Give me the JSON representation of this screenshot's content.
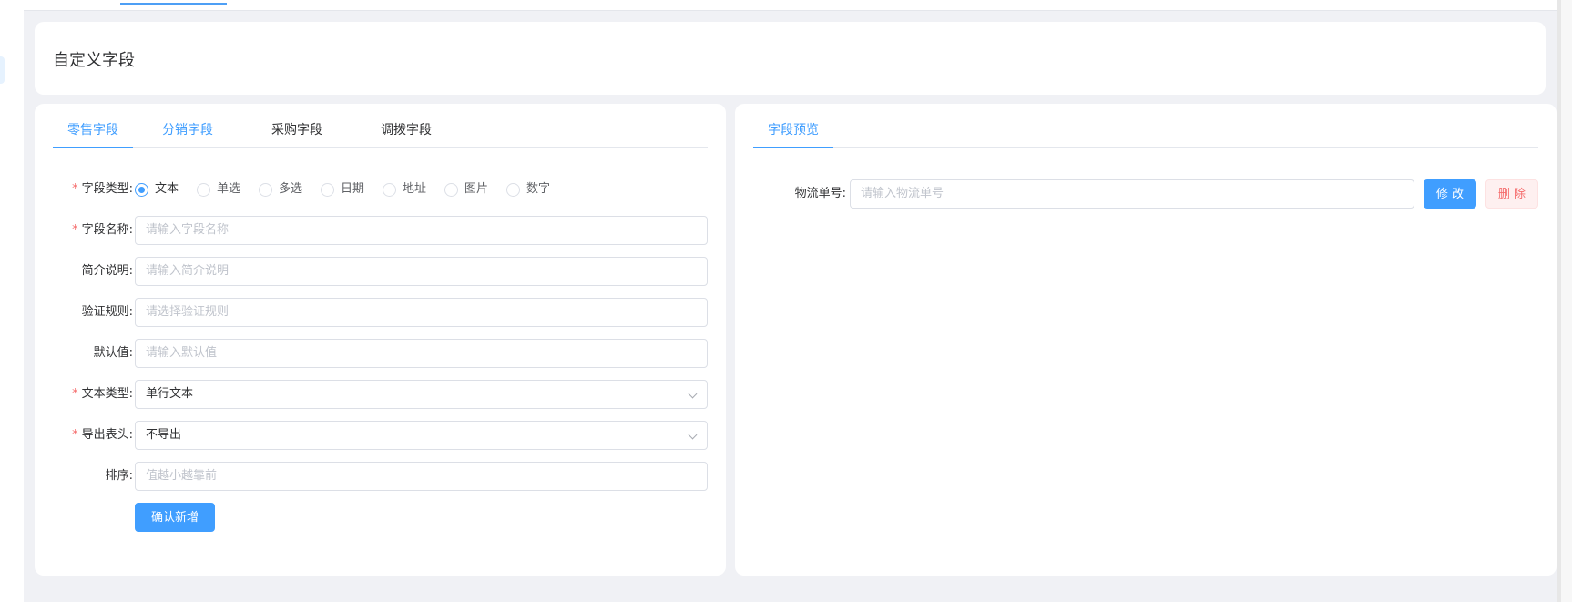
{
  "page_title": "自定义字段",
  "left_tabs": [
    {
      "label": "零售字段"
    },
    {
      "label": "分销字段"
    },
    {
      "label": "采购字段"
    },
    {
      "label": "调拨字段"
    }
  ],
  "form": {
    "field_type": {
      "label": "字段类型:",
      "options": [
        "文本",
        "单选",
        "多选",
        "日期",
        "地址",
        "图片",
        "数字"
      ],
      "selected": "文本"
    },
    "field_name": {
      "label": "字段名称:",
      "placeholder": "请输入字段名称"
    },
    "description": {
      "label": "简介说明:",
      "placeholder": "请输入简介说明"
    },
    "validation": {
      "label": "验证规则:",
      "placeholder": "请选择验证规则"
    },
    "default_value": {
      "label": "默认值:",
      "placeholder": "请输入默认值"
    },
    "text_type": {
      "label": "文本类型:",
      "value": "单行文本"
    },
    "export_header": {
      "label": "导出表头:",
      "value": "不导出"
    },
    "sort": {
      "label": "排序:",
      "placeholder": "值越小越靠前"
    },
    "submit_label": "确认新增"
  },
  "preview": {
    "tab_label": "字段预览",
    "field_label": "物流单号:",
    "field_placeholder": "请输入物流单号",
    "edit_label": "修 改",
    "delete_label": "删 除"
  },
  "colors": {
    "primary": "#409eff",
    "danger": "#f56c6c",
    "background": "#f0f1f5"
  }
}
